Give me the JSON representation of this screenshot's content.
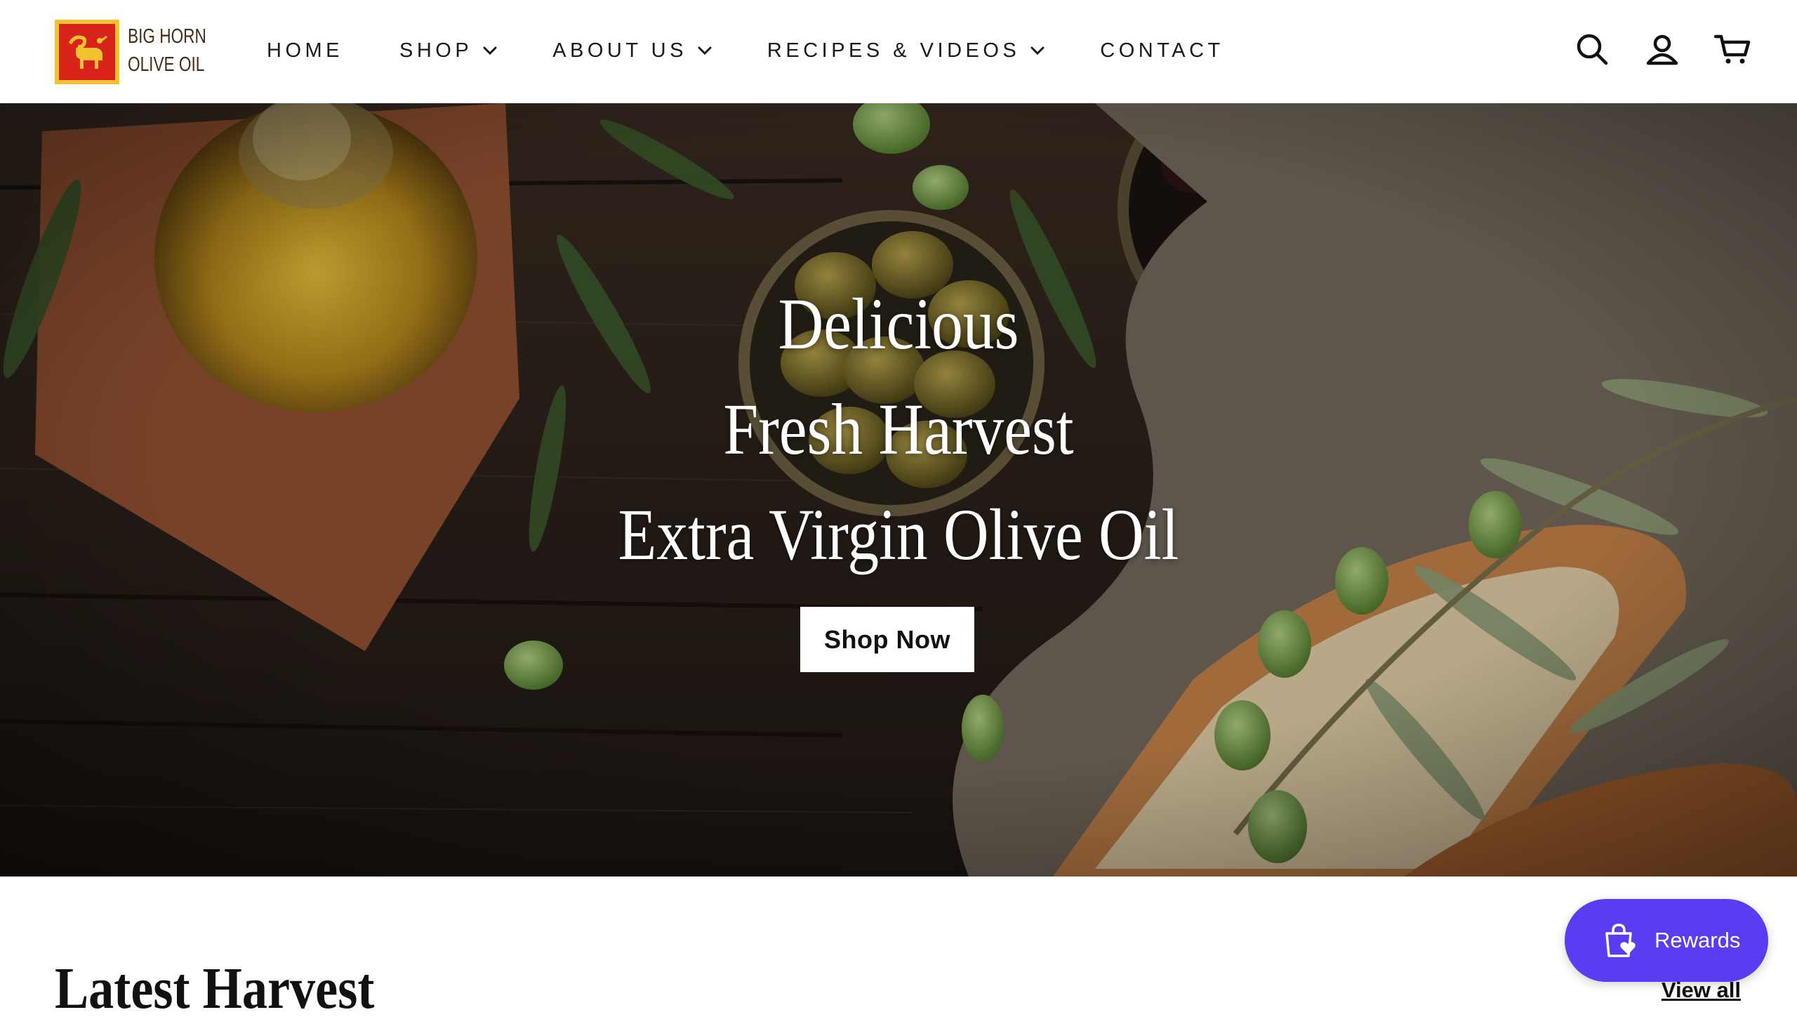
{
  "brand": {
    "logo_line1": "BIG HORN",
    "logo_line2": "OLIVE OIL",
    "colors": {
      "logo_red": "#d8231b",
      "logo_gold": "#f2c230",
      "logo_text": "#4a2a10"
    }
  },
  "nav": {
    "items": [
      {
        "label": "HOME",
        "has_dropdown": false
      },
      {
        "label": "SHOP",
        "has_dropdown": true
      },
      {
        "label": "ABOUT US",
        "has_dropdown": true
      },
      {
        "label": "RECIPES & VIDEOS",
        "has_dropdown": true
      },
      {
        "label": "CONTACT",
        "has_dropdown": false
      }
    ]
  },
  "header_icons": [
    "search-icon",
    "account-icon",
    "cart-icon"
  ],
  "hero": {
    "lines": [
      "Delicious",
      "Fresh Harvest",
      "Extra Virgin Olive Oil"
    ],
    "cta_label": "Shop Now"
  },
  "latest": {
    "title": "Latest Harvest",
    "view_all_label": "View all"
  },
  "rewards": {
    "label": "Rewards",
    "color": "#5a3df2"
  }
}
